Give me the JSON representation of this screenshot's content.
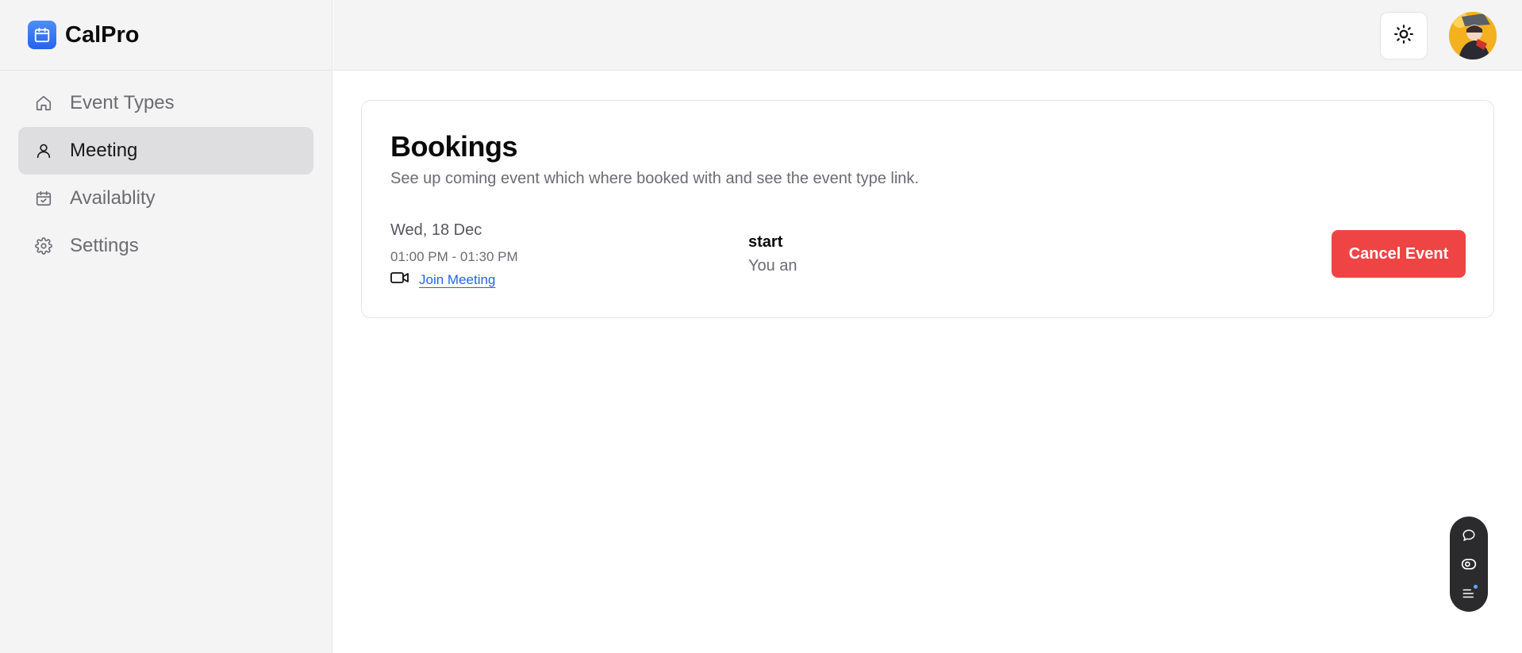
{
  "brand": {
    "name": "CalPro"
  },
  "sidebar": {
    "items": [
      {
        "label": "Event Types",
        "icon": "home-icon",
        "active": false
      },
      {
        "label": "Meeting",
        "icon": "user-icon",
        "active": true
      },
      {
        "label": "Availablity",
        "icon": "calendar-check-icon",
        "active": false
      },
      {
        "label": "Settings",
        "icon": "gear-icon",
        "active": false
      }
    ]
  },
  "topbar": {
    "theme_icon": "sun-icon",
    "avatar_icon": "avatar"
  },
  "bookings": {
    "title": "Bookings",
    "subtitle": "See up coming event which where booked with and see the event type link.",
    "items": [
      {
        "date": "Wed, 18 Dec",
        "time": "01:00 PM - 01:30 PM",
        "join_label": "Join Meeting",
        "event_title": "start",
        "event_desc": "You an",
        "cancel_label": "Cancel Event"
      }
    ]
  },
  "floating_toolbar": {
    "icons": [
      "chat-icon",
      "eye-icon",
      "list-icon"
    ]
  },
  "colors": {
    "accent": "#2563eb",
    "danger": "#ef4444",
    "sidebar_bg": "#f4f4f5",
    "active_bg": "#dedee0"
  }
}
